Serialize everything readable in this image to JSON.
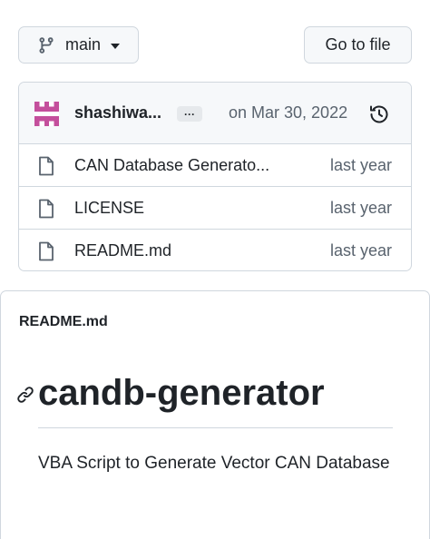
{
  "toolbar": {
    "branch_label": "main",
    "goto_label": "Go to file"
  },
  "commit": {
    "author": "shashiwa...",
    "ellipsis": "···",
    "date": "on Mar 30, 2022"
  },
  "files": [
    {
      "name": "CAN Database Generato...",
      "time": "last year"
    },
    {
      "name": "LICENSE",
      "time": "last year"
    },
    {
      "name": "README.md",
      "time": "last year"
    }
  ],
  "readme": {
    "header": "README.md",
    "title": "candb-generator",
    "description": "VBA Script to Generate Vector CAN Database"
  },
  "colors": {
    "avatar": "#c44f9c",
    "border": "#d0d7de",
    "muted_text": "#59636e"
  }
}
